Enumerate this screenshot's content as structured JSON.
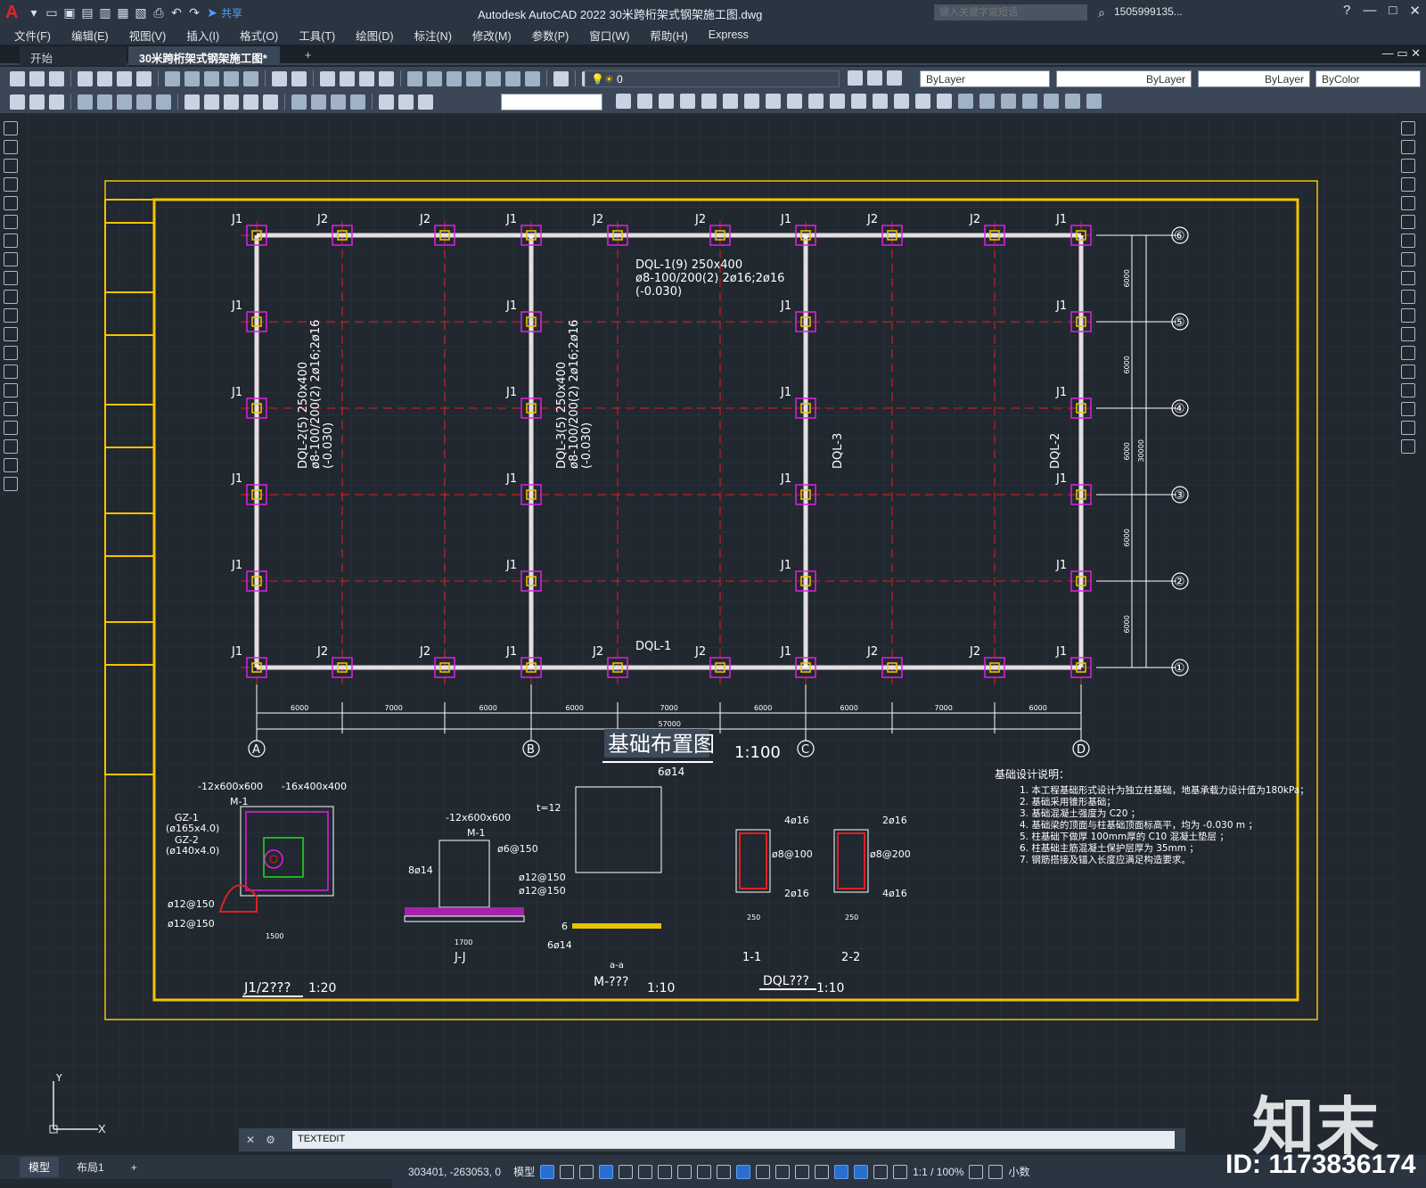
{
  "titlebar": {
    "app_logo": "A",
    "title": "Autodesk AutoCAD 2022    30米跨桁架式钢架施工图.dwg",
    "share_label": "共享",
    "search_placeholder": "键入关键字或短语",
    "username": "1505999135...",
    "window_controls": [
      "—",
      "□",
      "✕"
    ]
  },
  "menubar": {
    "items": [
      "文件(F)",
      "编辑(E)",
      "视图(V)",
      "插入(I)",
      "格式(O)",
      "工具(T)",
      "绘图(D)",
      "标注(N)",
      "修改(M)",
      "参数(P)",
      "窗口(W)",
      "帮助(H)",
      "Express"
    ]
  },
  "tabs": {
    "start": "开始",
    "drawing": "30米跨桁架式钢架施工图*",
    "close": "✕",
    "add": "+"
  },
  "toolbar": {
    "layer_value": "0",
    "color_value": "ByLayer",
    "linetype_value": "ByLayer",
    "lineweight_value": "ByLayer",
    "plotstyle_value": "ByColor"
  },
  "drawing": {
    "title": "基础布置图",
    "scale": "1:100",
    "grid_rows": [
      "⑥",
      "⑤",
      "④",
      "③",
      "②",
      "①"
    ],
    "grid_cols": [
      "A",
      "B",
      "C",
      "D"
    ],
    "dql1_label": "DQL-1(9)   250x400",
    "dql1_spec": "ø8-100/200(2)  2ø16;2ø16",
    "dql1_elev": "(-0.030)",
    "dql1_bottom": "DQL-1",
    "dql2_label": "DQL-2(5)  250x400",
    "dql2_spec": "ø8-100/200(2) 2ø16;2ø16",
    "dql2_elev": "(-0.030)",
    "dql3_label": "DQL-3(5)  250x400",
    "dql3_spec": "ø8-100/200(2) 2ø16;2ø16",
    "dql3_elev": "(-0.030)",
    "dql3_right": "DQL-3",
    "dql2_right": "DQL-2",
    "bottom_dims": [
      "6000",
      "7000",
      "6000",
      "6000",
      "7000",
      "6000",
      "6000",
      "7000",
      "6000"
    ],
    "total_dim": "57000",
    "right_dims": [
      "6000",
      "6000",
      "6000",
      "6000",
      "6000"
    ],
    "right_total": "30000",
    "j1": "J1",
    "j2": "J2",
    "notes_title": "基础设计说明：",
    "notes": [
      "1. 本工程基础形式设计为独立柱基础，地基承载力设计值为180kPa；",
      "2. 基础采用锥形基础；",
      "3. 基础混凝土强度为 C20 ；",
      "4. 基础梁的顶面与柱基础顶面标高平，均为 -0.030 m ；",
      "5. 柱基础下做厚 100mm厚的 C10 混凝土垫层 ；",
      "6. 柱基础主筋混凝土保护层厚为 35mm ；",
      "7. 钢筋搭接及锚入长度应满足构造要求。"
    ],
    "detail_j1": "J1/2???",
    "detail_j1_scale": "1:20",
    "detail_jj": "J-J",
    "detail_m": "M-???",
    "detail_m_scale": "1:10",
    "detail_dql": "DQL???",
    "detail_dql_scale": "1:10",
    "section_11": "1-1",
    "section_22": "2-2",
    "plate1": "-12x600x600",
    "plate2": "-16x400x400",
    "plate3": "-12x600x600",
    "m1": "M-1",
    "gz1": "GZ-1",
    "gz1_spec": "(ø165x4.0)",
    "gz2": "GZ-2",
    "gz2_spec": "(ø140x4.0)",
    "rebar_12_150": "ø12@150",
    "rebar_6_150": "ø6@150",
    "rebar_8_14": "8ø14",
    "rebar_6_14": "6ø14",
    "t12": "t=12",
    "rebar_4_16": "4ø16",
    "rebar_2_16": "2ø16",
    "rebar_8_100": "ø8@100",
    "rebar_8_200": "ø8@200",
    "six": "6",
    "aa": "a-a",
    "dim_250": "250",
    "dim_1500": "1500",
    "dim_1700": "1700"
  },
  "command": {
    "value": "TEXTEDIT"
  },
  "layout_tabs": [
    "模型",
    "布局1",
    "+"
  ],
  "status": {
    "coords": "303401, -263053, 0",
    "model": "模型",
    "scale": "1:1 / 100%",
    "units": "小数"
  },
  "watermark": {
    "logo": "知末",
    "id": "ID: 1173836174"
  },
  "colors": {
    "frame": "#f5c400",
    "axis": "#e02020",
    "column": "#e020e0",
    "beam": "#ffffff",
    "dim": "#20e020",
    "text": "#ffffff",
    "accent": "#2a6fd0"
  }
}
